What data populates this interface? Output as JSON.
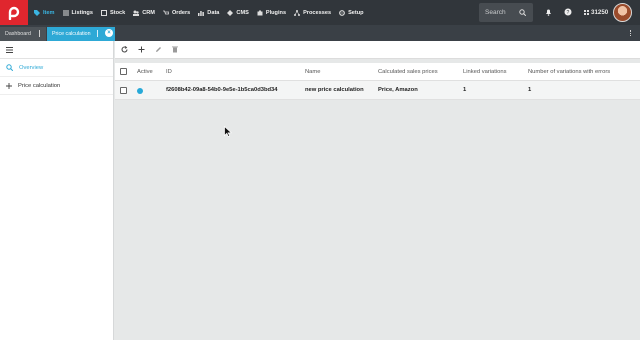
{
  "topbar": {
    "nav": [
      {
        "label": "Item",
        "icon": "tag-icon",
        "active": true
      },
      {
        "label": "Listings",
        "icon": "list-icon"
      },
      {
        "label": "Stock",
        "icon": "box-icon"
      },
      {
        "label": "CRM",
        "icon": "people-icon"
      },
      {
        "label": "Orders",
        "icon": "cart-icon"
      },
      {
        "label": "Data",
        "icon": "data-icon"
      },
      {
        "label": "CMS",
        "icon": "cms-icon"
      },
      {
        "label": "Plugins",
        "icon": "puzzle-icon"
      },
      {
        "label": "Processes",
        "icon": "process-icon"
      },
      {
        "label": "Setup",
        "icon": "gear-icon"
      }
    ],
    "search_placeholder": "Search",
    "user_number": "31250"
  },
  "tabs": {
    "dashboard": "Dashboard",
    "price_calculation": "Price calculation",
    "close": "×"
  },
  "sidebar": {
    "items": [
      {
        "label": "Overview",
        "icon": "search-icon",
        "active": true
      },
      {
        "label": "Price calculation",
        "icon": "plus-icon"
      }
    ]
  },
  "table": {
    "headers": [
      "Active",
      "ID",
      "Name",
      "Calculated sales prices",
      "Linked variations",
      "Number of variations with errors"
    ],
    "rows": [
      {
        "active": true,
        "id": "f2608b42-09a8-54b0-9e5e-1b5ca0d3bd34",
        "name": "new price calculation",
        "prices": "Price, Amazon",
        "linked": "1",
        "errors": "1"
      }
    ]
  },
  "colors": {
    "brand": "#e0262e",
    "accent": "#2ea9d6",
    "topbar": "#31363b"
  }
}
